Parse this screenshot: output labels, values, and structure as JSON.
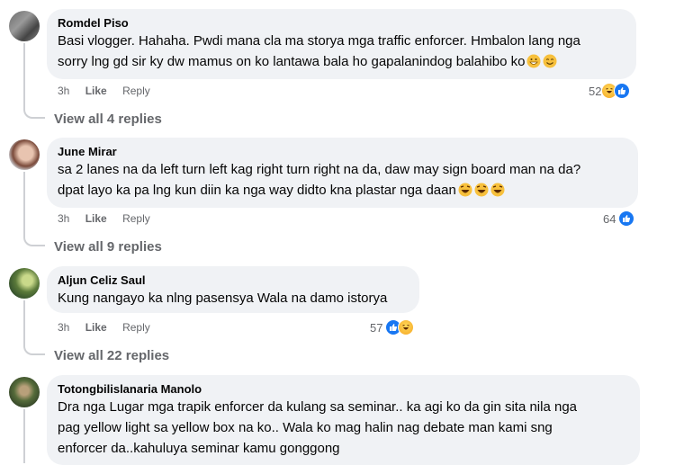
{
  "comments": [
    {
      "author": "Romdel Piso",
      "lines": [
        "Basi vlogger. Hahaha. Pwdi mana cla ma storya mga traffic enforcer. Hmbalon lang nga",
        "sorry lng gd sir ky dw mamus on ko lantawa bala ho gapalanindog balahibo ko"
      ],
      "time": "3h",
      "like_label": "Like",
      "reply_label": "Reply",
      "reaction_count": "52",
      "view_replies": "View all 4 replies"
    },
    {
      "author": "June Mirar",
      "lines": [
        "sa 2 lanes na da left turn left kag right turn right na da, daw may sign board man na da?",
        "dpat layo ka pa lng kun diin ka nga way didto kna plastar nga daan"
      ],
      "time": "3h",
      "like_label": "Like",
      "reply_label": "Reply",
      "reaction_count": "64",
      "view_replies": "View all 9 replies"
    },
    {
      "author": "Aljun Celiz Saul",
      "lines": [
        "Kung nangayo ka nlng pasensya Wala na damo istorya"
      ],
      "time": "3h",
      "like_label": "Like",
      "reply_label": "Reply",
      "reaction_count": "57",
      "view_replies": "View all 22 replies"
    },
    {
      "author": "Totongbilislanaria Manolo",
      "lines": [
        "Dra nga Lugar mga trapik enforcer da kulang sa seminar.. ka agi ko da gin sita nila nga",
        "pag yellow light sa yellow box na ko.. Wala ko mag halin nag debate man kami sng",
        "enforcer da..kahuluya seminar kamu gonggong"
      ]
    }
  ],
  "colors": {
    "bubble": "#f0f2f5",
    "meta": "#65676b",
    "like_blue": "#1877f2",
    "laugh_yellow": "#f7b928"
  }
}
